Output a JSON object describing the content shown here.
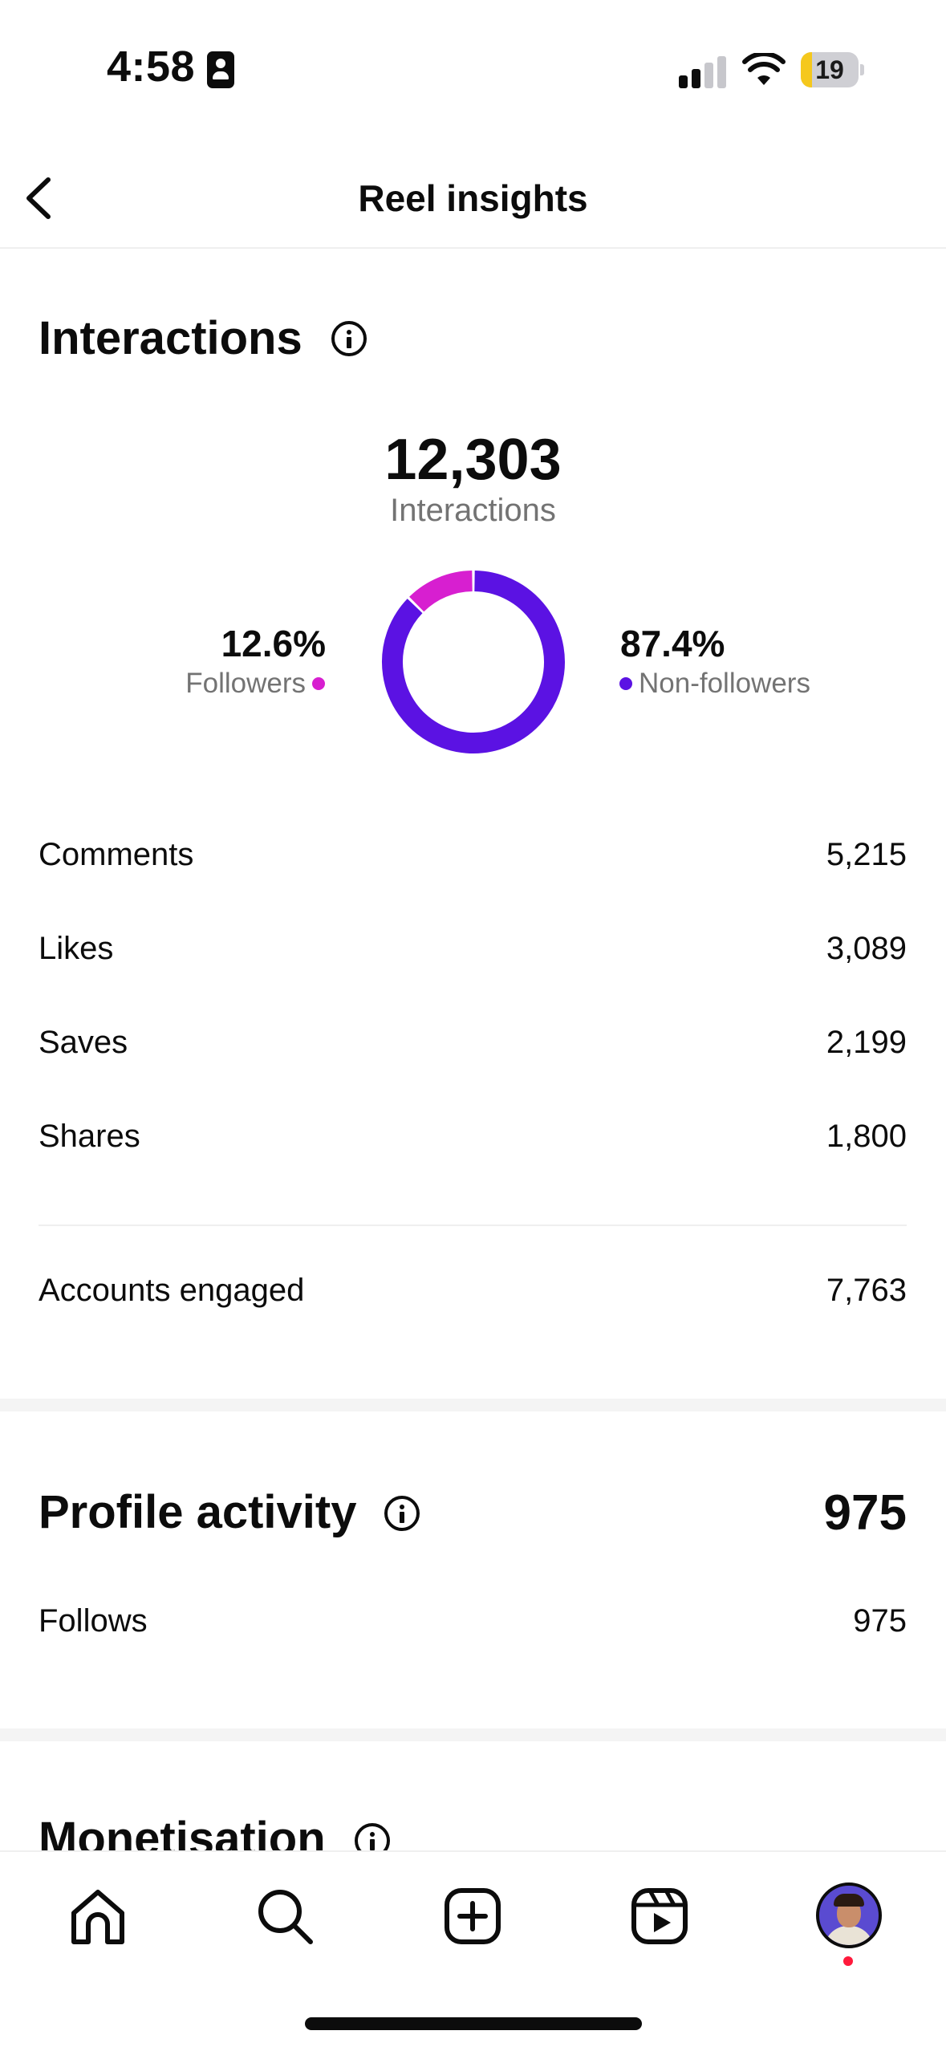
{
  "status_bar": {
    "time": "4:58",
    "battery_level": "19",
    "battery_fraction": 0.19
  },
  "header": {
    "title": "Reel insights"
  },
  "interactions": {
    "title": "Interactions",
    "total": "12,303",
    "total_label": "Interactions",
    "followers_pct": "12.6%",
    "followers_label": "Followers",
    "non_followers_pct": "87.4%",
    "non_followers_label": "Non-followers",
    "rows": [
      {
        "label": "Comments",
        "value": "5,215"
      },
      {
        "label": "Likes",
        "value": "3,089"
      },
      {
        "label": "Saves",
        "value": "2,199"
      },
      {
        "label": "Shares",
        "value": "1,800"
      }
    ],
    "accounts_engaged": {
      "label": "Accounts engaged",
      "value": "7,763"
    }
  },
  "profile_activity": {
    "title": "Profile activity",
    "total": "975",
    "rows": [
      {
        "label": "Follows",
        "value": "975"
      }
    ]
  },
  "monetisation": {
    "title": "Monetisation"
  },
  "chart_data": {
    "type": "pie",
    "categories": [
      "Followers",
      "Non-followers"
    ],
    "values": [
      12.6,
      87.4
    ],
    "colors": [
      "#d71fd0",
      "#5b12e3"
    ]
  },
  "tab_bar": {
    "items": [
      "home-icon",
      "search-icon",
      "create-icon",
      "reels-icon",
      "profile-avatar"
    ]
  },
  "colors": {
    "followers": "#d71fd0",
    "non_followers": "#5b12e3",
    "notification": "#ff1a3c",
    "battery": "#f5c81d"
  }
}
